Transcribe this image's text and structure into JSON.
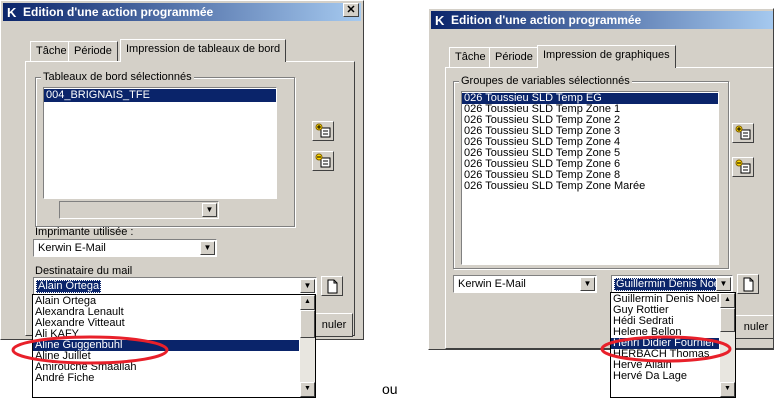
{
  "left": {
    "title": "Edition d'une action programmée",
    "close": "✕",
    "tabs": [
      "Tâche",
      "Période",
      "Impression de tableaux de bord"
    ],
    "group_label": "Tableaux de bord sélectionnés",
    "list_items": [
      "004_BRIGNAIS_TFE"
    ],
    "printer_label": "Imprimante utilisée :",
    "printer_value": "Kerwin E-Mail",
    "recipient_label": "Destinataire du mail",
    "recipient_value": "Alain Ortega",
    "cancel_partial": "nuler",
    "dropdown_items": [
      "Alain Ortega",
      "Alexandra Lenault",
      "Alexandre Vitteaut",
      "Ali KAFY",
      "Aline Guggenbuhl",
      "Aline Juillet",
      "Amirouche Smaallah",
      "André Fiche"
    ],
    "highlighted_index": 4
  },
  "right": {
    "title": "Edition d'une action programmée",
    "tabs": [
      "Tâche",
      "Période",
      "Impression de graphiques"
    ],
    "group_label": "Groupes de variables sélectionnés",
    "list_items": [
      "026 Toussieu SLD Temp EG",
      "026 Toussieu SLD Temp Zone 1",
      "026 Toussieu SLD Temp Zone 2",
      "026 Toussieu SLD Temp Zone 3",
      "026 Toussieu SLD Temp Zone 4",
      "026 Toussieu SLD Temp Zone 5",
      "026 Toussieu SLD Temp Zone 6",
      "026 Toussieu SLD Temp Zone 8",
      "026 Toussieu SLD Temp Zone Marée"
    ],
    "printer_value": "Kerwin E-Mail",
    "recipient_value": "Guillermin Denis Noel",
    "cancel_partial": "nuler",
    "dropdown_items": [
      "Guillermin Denis Noel",
      "Guy Rottier",
      "Hédi Sedrati",
      "Helene Bellon",
      "Henri Didier Fournier",
      "HERBACH Thomas",
      "Herve Allain",
      "Hervé Da Lage"
    ],
    "highlighted_index": 4
  },
  "separator_text": "ou",
  "colors": {
    "selection": "#0a246a",
    "highlight_ellipse": "#e8202a",
    "window": "#d4d0c8"
  }
}
